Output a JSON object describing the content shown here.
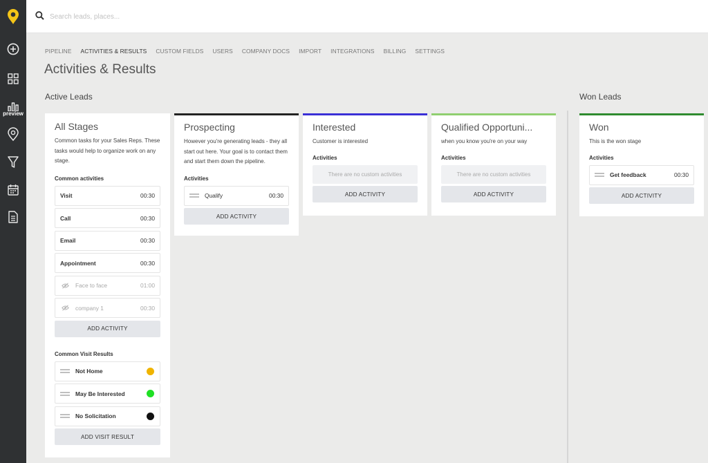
{
  "search": {
    "placeholder": "Search leads, places..."
  },
  "rail": {
    "preview_label": "preview"
  },
  "nav": {
    "items": [
      "PIPELINE",
      "ACTIVITIES & RESULTS",
      "CUSTOM FIELDS",
      "USERS",
      "COMPANY DOCS",
      "IMPORT",
      "INTEGRATIONS",
      "BILLING",
      "SETTINGS"
    ],
    "active": "ACTIVITIES & RESULTS"
  },
  "page_title": "Activities & Results",
  "sections": {
    "active": "Active Leads",
    "won": "Won Leads"
  },
  "colors": {
    "logo": "#f5c518",
    "prospecting": "#222222",
    "interested": "#3a2fd6",
    "qualified": "#8fcf6f",
    "won": "#2e8b2e",
    "not_home": "#f0b400",
    "may_be_interested": "#1fe024",
    "no_solicitation": "#111111"
  },
  "all_stages": {
    "title": "All Stages",
    "desc": "Common tasks for your Sales Reps. These tasks would help to organize work on any stage.",
    "common_label": "Common activities",
    "activities": [
      {
        "name": "Visit",
        "time": "00:30"
      },
      {
        "name": "Call",
        "time": "00:30"
      },
      {
        "name": "Email",
        "time": "00:30"
      },
      {
        "name": "Appointment",
        "time": "00:30"
      },
      {
        "name": "Face to face",
        "time": "01:00"
      },
      {
        "name": "company 1",
        "time": "00:30"
      }
    ],
    "add_activity": "ADD ACTIVITY",
    "results_label": "Common Visit Results",
    "results": [
      {
        "name": "Not Home"
      },
      {
        "name": "May Be Interested"
      },
      {
        "name": "No Solicitation"
      }
    ],
    "add_result": "ADD VISIT RESULT"
  },
  "prospecting": {
    "title": "Prospecting",
    "desc": "However you're generating leads - they all start out here. Your goal is to contact them and start them down the pipeline.",
    "label": "Activities",
    "activity": {
      "name": "Qualify",
      "time": "00:30"
    },
    "add_activity": "ADD ACTIVITY"
  },
  "interested": {
    "title": "Interested",
    "desc": "Customer is interested",
    "label": "Activities",
    "empty": "There are no custom activities",
    "add_activity": "ADD ACTIVITY"
  },
  "qualified": {
    "title": "Qualified Opportuni...",
    "desc": "when you know you're on your way",
    "label": "Activities",
    "empty": "There are no custom activities",
    "add_activity": "ADD ACTIVITY"
  },
  "won": {
    "title": "Won",
    "desc": "This is the won stage",
    "label": "Activities",
    "activity": {
      "name": "Get feedback",
      "time": "00:30"
    },
    "add_activity": "ADD ACTIVITY"
  }
}
